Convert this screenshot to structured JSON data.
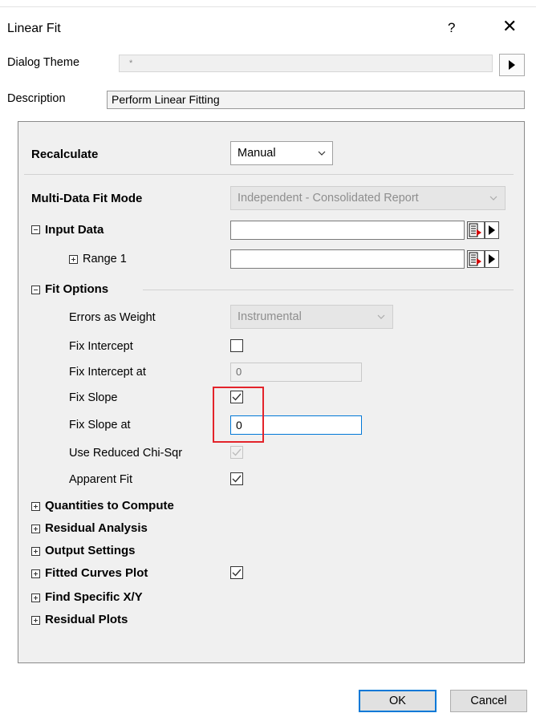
{
  "window": {
    "title": "Linear Fit",
    "help_glyph": "?",
    "close_glyph": "✕"
  },
  "dialog_theme": {
    "label": "Dialog Theme",
    "value": "*"
  },
  "description": {
    "label": "Description",
    "value": "Perform Linear Fitting"
  },
  "recalculate": {
    "label": "Recalculate",
    "value": "Manual"
  },
  "multi_data_fit_mode": {
    "label": "Multi-Data Fit Mode",
    "value": "Independent - Consolidated Report"
  },
  "input_data": {
    "label": "Input Data",
    "range_label": "Range 1",
    "value": "",
    "range_value": ""
  },
  "fit_options": {
    "label": "Fit Options",
    "errors_as_weight": {
      "label": "Errors as Weight",
      "value": "Instrumental"
    },
    "fix_intercept": {
      "label": "Fix Intercept",
      "checked": false
    },
    "fix_intercept_at": {
      "label": "Fix Intercept at",
      "value": "0"
    },
    "fix_slope": {
      "label": "Fix Slope",
      "checked": true
    },
    "fix_slope_at": {
      "label": "Fix Slope at",
      "value": "0"
    },
    "use_reduced_chi_sqr": {
      "label": "Use Reduced Chi-Sqr",
      "checked": true
    },
    "apparent_fit": {
      "label": "Apparent Fit",
      "checked": true
    }
  },
  "sections": {
    "quantities": "Quantities to Compute",
    "residual_analysis": "Residual Analysis",
    "output_settings": "Output Settings",
    "fitted_curves": "Fitted Curves Plot",
    "find_xy": "Find Specific X/Y",
    "residual_plots": "Residual Plots"
  },
  "buttons": {
    "ok": "OK",
    "cancel": "Cancel"
  },
  "colors": {
    "highlight": "#e3242b",
    "focus": "#0078d7",
    "panel": "#f0f0f0"
  }
}
